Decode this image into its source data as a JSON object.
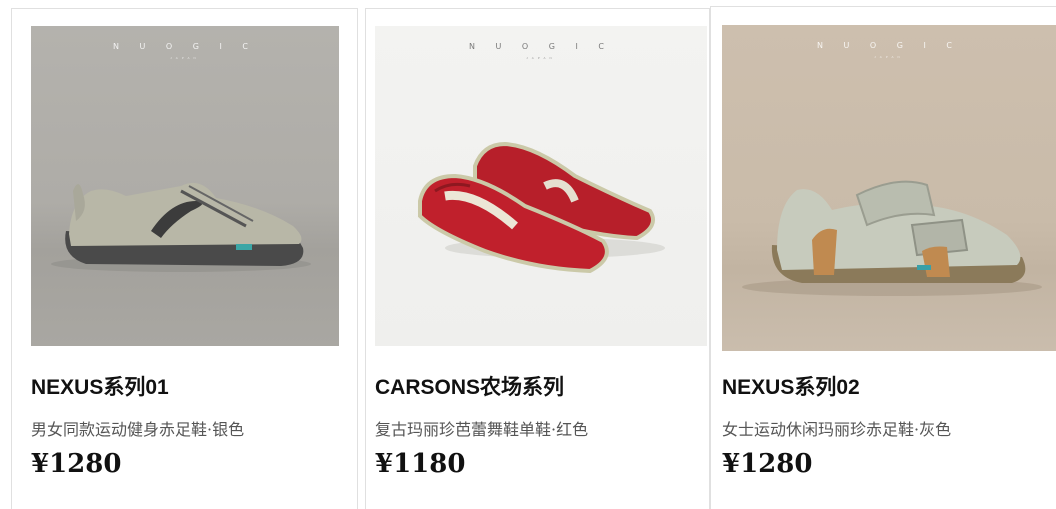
{
  "products": [
    {
      "brand": "N U O G I C",
      "brand_sub": "JAPAN",
      "title": "NEXUS系列01",
      "subtitle": "男女同款运动健身赤足鞋·银色",
      "price": "¥1280"
    },
    {
      "brand": "N U O G I C",
      "brand_sub": "JAPAN",
      "title": "CARSONS农场系列",
      "subtitle": "复古玛丽珍芭蕾舞鞋单鞋·红色",
      "price": "¥1180"
    },
    {
      "brand": "N U O G I C",
      "brand_sub": "JAPAN",
      "title": "NEXUS系列02",
      "subtitle": "女士运动休闲玛丽珍赤足鞋·灰色",
      "price": "¥1280"
    }
  ]
}
